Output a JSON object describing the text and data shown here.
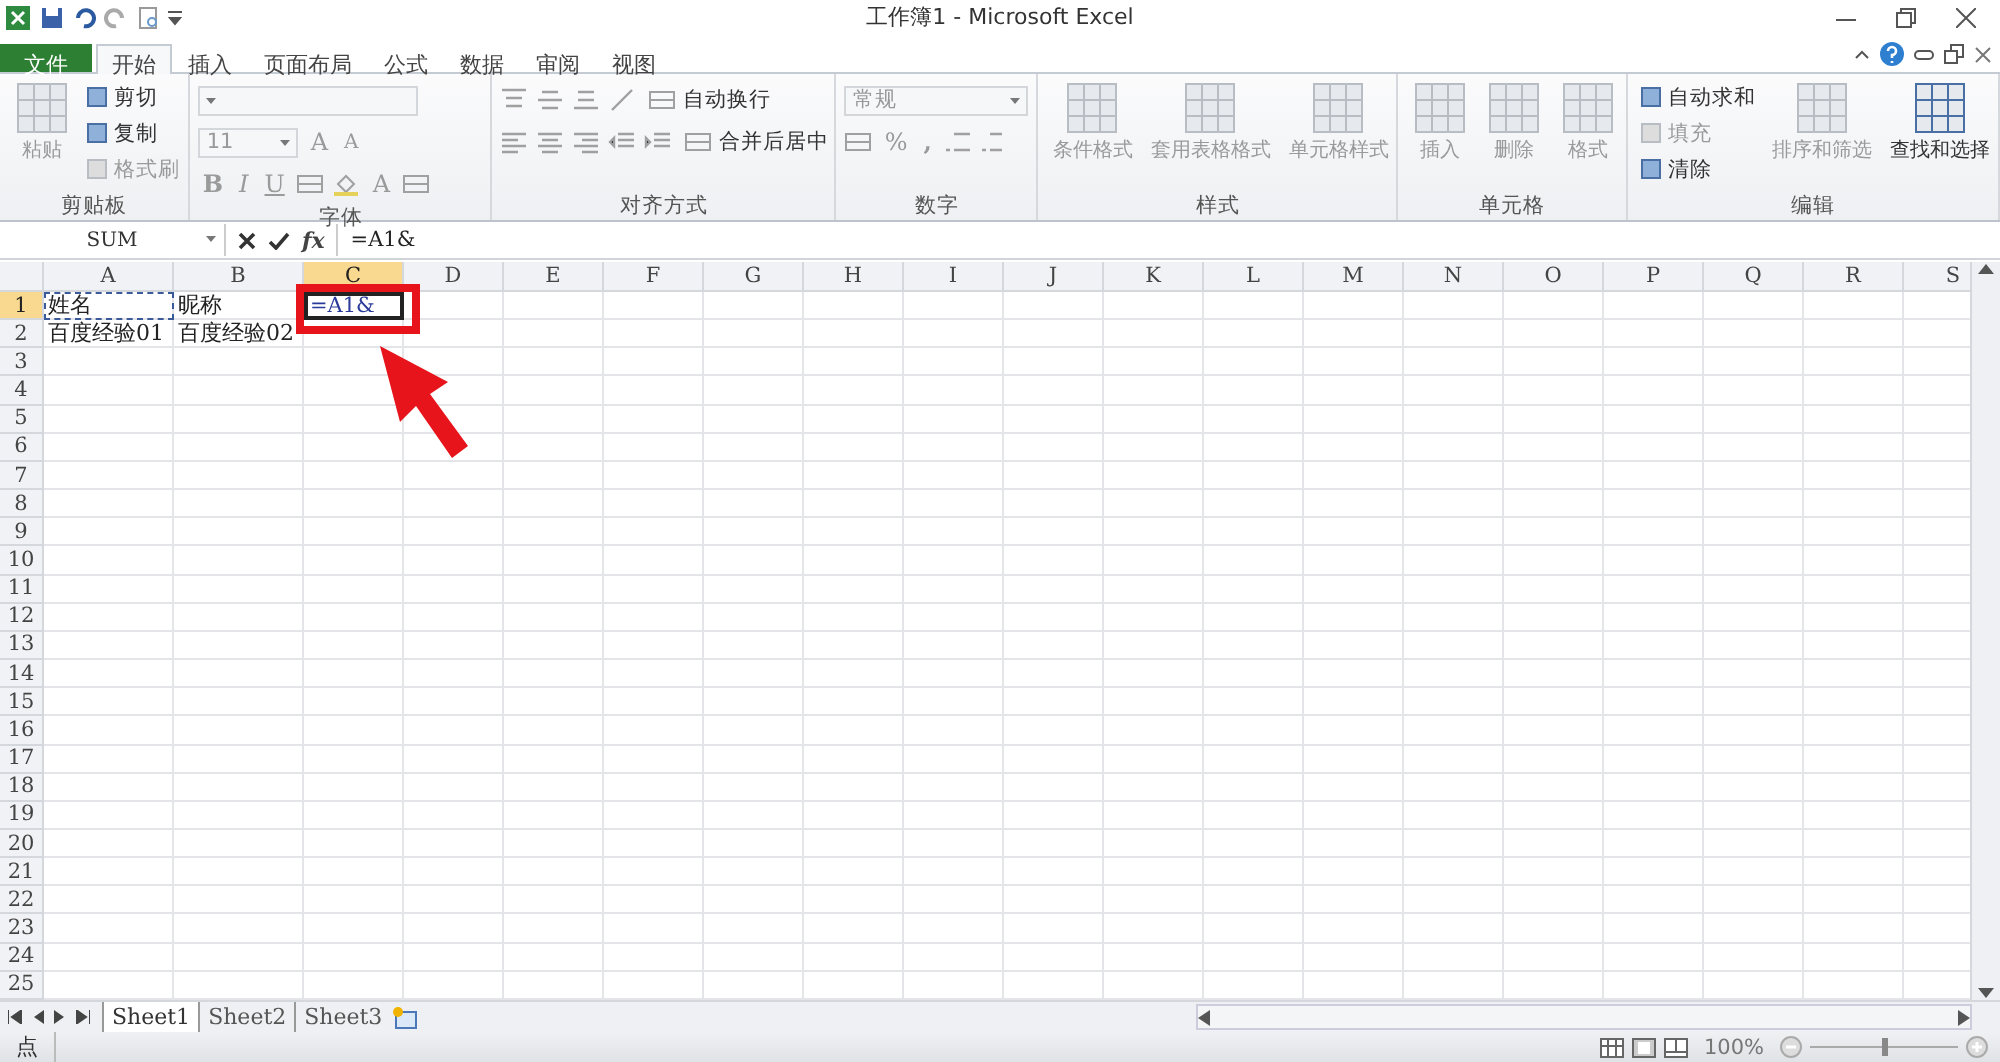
{
  "window": {
    "title": "工作簿1 - Microsoft Excel"
  },
  "tabs": [
    {
      "label": "文件",
      "kind": "file",
      "selected": false
    },
    {
      "label": "开始",
      "kind": "tab",
      "selected": true
    },
    {
      "label": "插入",
      "kind": "tab",
      "selected": false
    },
    {
      "label": "页面布局",
      "kind": "tab",
      "selected": false
    },
    {
      "label": "公式",
      "kind": "tab",
      "selected": false
    },
    {
      "label": "数据",
      "kind": "tab",
      "selected": false
    },
    {
      "label": "审阅",
      "kind": "tab",
      "selected": false
    },
    {
      "label": "视图",
      "kind": "tab",
      "selected": false
    }
  ],
  "ribbon": [
    {
      "label": "剪贴板",
      "kind": "clipboard",
      "items": [
        {
          "kind": "large",
          "label": "粘贴",
          "disabled": true
        },
        {
          "kind": "small",
          "label": "剪切",
          "disabled": false
        },
        {
          "kind": "small",
          "label": "复制",
          "disabled": false
        },
        {
          "kind": "small",
          "label": "格式刷",
          "disabled": true
        }
      ]
    },
    {
      "label": "字体",
      "kind": "font",
      "disabled": true,
      "size": "11",
      "grow": "A",
      "shrink": "A",
      "bold": "B",
      "italic": "I",
      "underline": "U",
      "color_letter": "A"
    },
    {
      "label": "对齐方式",
      "kind": "align",
      "disabled": true,
      "wrap": "自动换行",
      "merge": "合并后居中"
    },
    {
      "label": "数字",
      "kind": "number",
      "disabled": true,
      "format": "常规",
      "percent": "%",
      "comma": ","
    },
    {
      "label": "样式",
      "kind": "buttons",
      "items": [
        {
          "kind": "large",
          "label": "条件格式",
          "disabled": true
        },
        {
          "kind": "large",
          "label": "套用表格格式",
          "disabled": true
        },
        {
          "kind": "large",
          "label": "单元格样式",
          "disabled": true
        }
      ]
    },
    {
      "label": "单元格",
      "kind": "buttons",
      "items": [
        {
          "kind": "large",
          "label": "插入",
          "disabled": true
        },
        {
          "kind": "large",
          "label": "删除",
          "disabled": true
        },
        {
          "kind": "large",
          "label": "格式",
          "disabled": true
        }
      ]
    },
    {
      "label": "编辑",
      "kind": "buttons",
      "items": [
        {
          "kind": "small",
          "label": "自动求和",
          "disabled": false
        },
        {
          "kind": "small",
          "label": "填充",
          "disabled": true
        },
        {
          "kind": "small",
          "label": "清除",
          "disabled": false
        },
        {
          "kind": "large",
          "label": "排序和筛选",
          "disabled": true
        },
        {
          "kind": "large",
          "label": "查找和选择",
          "disabled": false
        }
      ]
    }
  ],
  "formula_bar": {
    "name_box": "SUM",
    "fx": "fx",
    "formula": "=A1&"
  },
  "columns": [
    {
      "label": "A",
      "selected": false
    },
    {
      "label": "B",
      "selected": false
    },
    {
      "label": "C",
      "selected": true
    },
    {
      "label": "D",
      "selected": false
    },
    {
      "label": "E",
      "selected": false
    },
    {
      "label": "F",
      "selected": false
    },
    {
      "label": "G",
      "selected": false
    },
    {
      "label": "H",
      "selected": false
    },
    {
      "label": "I",
      "selected": false
    },
    {
      "label": "J",
      "selected": false
    },
    {
      "label": "K",
      "selected": false
    },
    {
      "label": "L",
      "selected": false
    },
    {
      "label": "M",
      "selected": false
    },
    {
      "label": "N",
      "selected": false
    },
    {
      "label": "O",
      "selected": false
    },
    {
      "label": "P",
      "selected": false
    },
    {
      "label": "Q",
      "selected": false
    },
    {
      "label": "R",
      "selected": false
    },
    {
      "label": "S",
      "selected": false
    }
  ],
  "rows": [
    {
      "number": "1",
      "selected": true,
      "cells": [
        {
          "text": "姓名",
          "referenced": true,
          "editing": false
        },
        {
          "text": "昵称",
          "referenced": false,
          "editing": false
        },
        {
          "text": "=A1&",
          "referenced": false,
          "editing": true
        }
      ]
    },
    {
      "number": "2",
      "selected": false,
      "cells": [
        {
          "text": "百度经验01",
          "referenced": false,
          "editing": false
        },
        {
          "text": "百度经验02",
          "referenced": false,
          "editing": false
        }
      ]
    },
    {
      "number": "3",
      "selected": false
    },
    {
      "number": "4",
      "selected": false
    },
    {
      "number": "5",
      "selected": false
    },
    {
      "number": "6",
      "selected": false
    },
    {
      "number": "7",
      "selected": false
    },
    {
      "number": "8",
      "selected": false
    },
    {
      "number": "9",
      "selected": false
    },
    {
      "number": "10",
      "selected": false
    },
    {
      "number": "11",
      "selected": false
    },
    {
      "number": "12",
      "selected": false
    },
    {
      "number": "13",
      "selected": false
    },
    {
      "number": "14",
      "selected": false
    },
    {
      "number": "15",
      "selected": false
    },
    {
      "number": "16",
      "selected": false
    },
    {
      "number": "17",
      "selected": false
    },
    {
      "number": "18",
      "selected": false
    },
    {
      "number": "19",
      "selected": false
    },
    {
      "number": "20",
      "selected": false
    },
    {
      "number": "21",
      "selected": false
    },
    {
      "number": "22",
      "selected": false
    },
    {
      "number": "23",
      "selected": false
    },
    {
      "number": "24",
      "selected": false
    },
    {
      "number": "25",
      "selected": false
    }
  ],
  "sheets": [
    {
      "label": "Sheet1",
      "selected": true
    },
    {
      "label": "Sheet2",
      "selected": false
    },
    {
      "label": "Sheet3",
      "selected": false
    }
  ],
  "status_bar": {
    "mode": "点",
    "zoom": "100%",
    "zoom_slider": {
      "level": 0.5
    }
  }
}
